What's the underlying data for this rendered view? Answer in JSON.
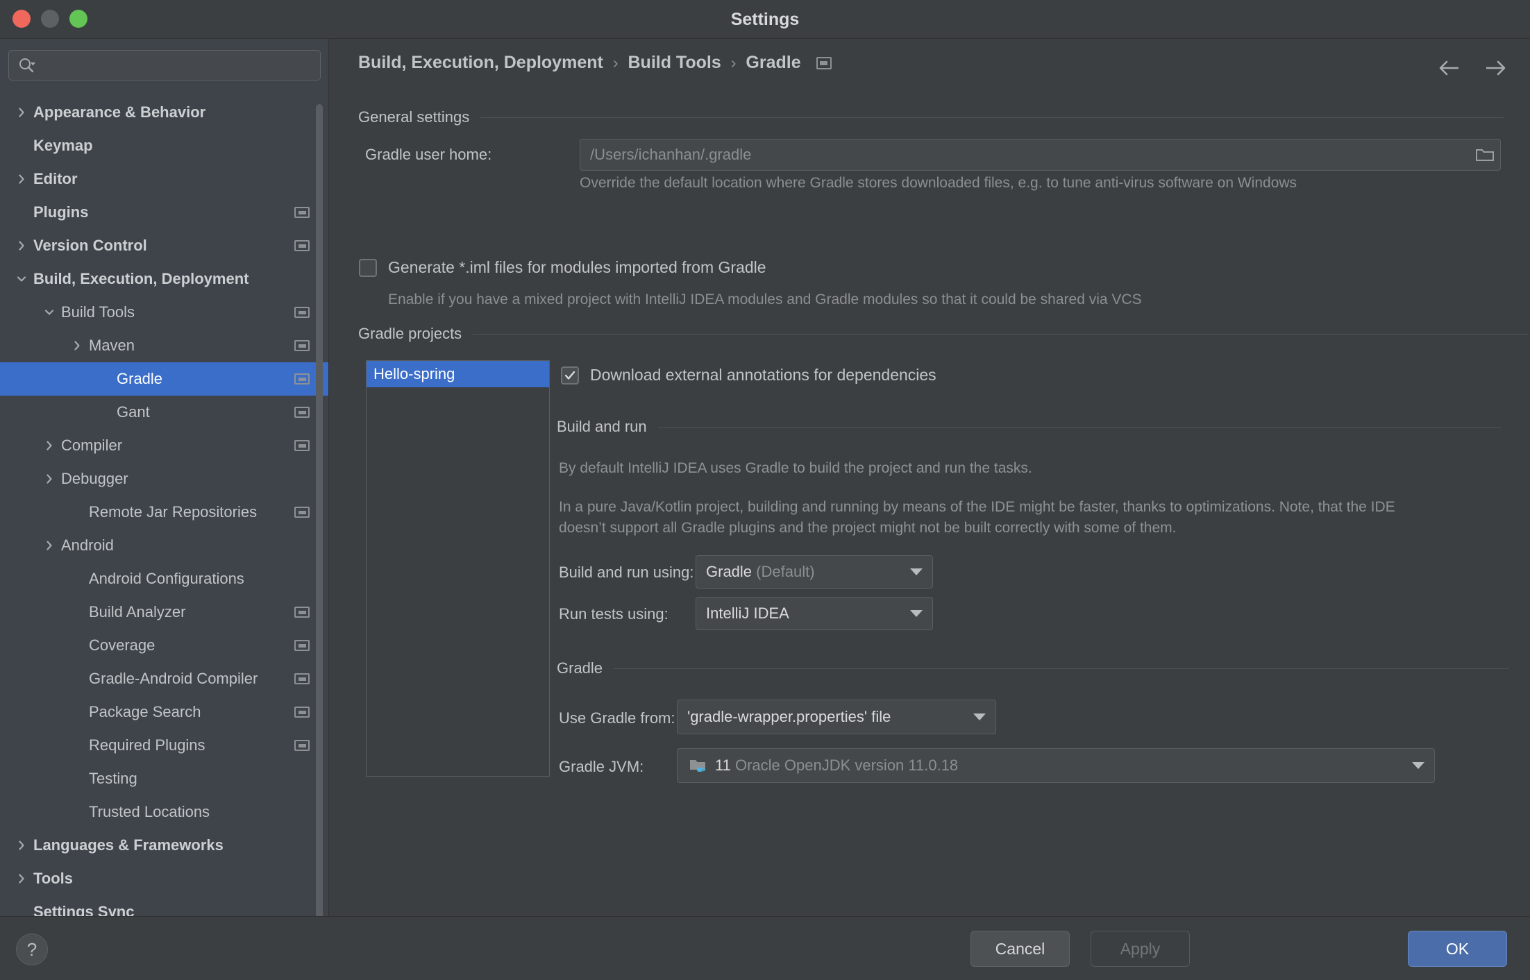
{
  "window": {
    "title": "Settings"
  },
  "sidebar": {
    "search": {
      "value": "",
      "placeholder": ""
    },
    "items": [
      {
        "label": "Appearance & Behavior",
        "indent": 0,
        "bold": true,
        "arrow": "right",
        "badge": false,
        "selected": false
      },
      {
        "label": "Keymap",
        "indent": 0,
        "bold": true,
        "arrow": "none",
        "badge": false,
        "selected": false
      },
      {
        "label": "Editor",
        "indent": 0,
        "bold": true,
        "arrow": "right",
        "badge": false,
        "selected": false
      },
      {
        "label": "Plugins",
        "indent": 0,
        "bold": true,
        "arrow": "none",
        "badge": true,
        "selected": false
      },
      {
        "label": "Version Control",
        "indent": 0,
        "bold": true,
        "arrow": "right",
        "badge": true,
        "selected": false
      },
      {
        "label": "Build, Execution, Deployment",
        "indent": 0,
        "bold": true,
        "arrow": "down",
        "badge": false,
        "selected": false
      },
      {
        "label": "Build Tools",
        "indent": 1,
        "bold": false,
        "arrow": "down",
        "badge": true,
        "selected": false
      },
      {
        "label": "Maven",
        "indent": 2,
        "bold": false,
        "arrow": "right",
        "badge": true,
        "selected": false
      },
      {
        "label": "Gradle",
        "indent": 3,
        "bold": false,
        "arrow": "none",
        "badge": true,
        "selected": true
      },
      {
        "label": "Gant",
        "indent": 3,
        "bold": false,
        "arrow": "none",
        "badge": true,
        "selected": false
      },
      {
        "label": "Compiler",
        "indent": 1,
        "bold": false,
        "arrow": "right",
        "badge": true,
        "selected": false
      },
      {
        "label": "Debugger",
        "indent": 1,
        "bold": false,
        "arrow": "right",
        "badge": false,
        "selected": false
      },
      {
        "label": "Remote Jar Repositories",
        "indent": 2,
        "bold": false,
        "arrow": "none",
        "badge": true,
        "selected": false
      },
      {
        "label": "Android",
        "indent": 1,
        "bold": false,
        "arrow": "right",
        "badge": false,
        "selected": false
      },
      {
        "label": "Android Configurations",
        "indent": 2,
        "bold": false,
        "arrow": "none",
        "badge": false,
        "selected": false
      },
      {
        "label": "Build Analyzer",
        "indent": 2,
        "bold": false,
        "arrow": "none",
        "badge": true,
        "selected": false
      },
      {
        "label": "Coverage",
        "indent": 2,
        "bold": false,
        "arrow": "none",
        "badge": true,
        "selected": false
      },
      {
        "label": "Gradle-Android Compiler",
        "indent": 2,
        "bold": false,
        "arrow": "none",
        "badge": true,
        "selected": false
      },
      {
        "label": "Package Search",
        "indent": 2,
        "bold": false,
        "arrow": "none",
        "badge": true,
        "selected": false
      },
      {
        "label": "Required Plugins",
        "indent": 2,
        "bold": false,
        "arrow": "none",
        "badge": true,
        "selected": false
      },
      {
        "label": "Testing",
        "indent": 2,
        "bold": false,
        "arrow": "none",
        "badge": false,
        "selected": false
      },
      {
        "label": "Trusted Locations",
        "indent": 2,
        "bold": false,
        "arrow": "none",
        "badge": false,
        "selected": false
      },
      {
        "label": "Languages & Frameworks",
        "indent": 0,
        "bold": true,
        "arrow": "right",
        "badge": false,
        "selected": false
      },
      {
        "label": "Tools",
        "indent": 0,
        "bold": true,
        "arrow": "right",
        "badge": false,
        "selected": false
      },
      {
        "label": "Settings Sync",
        "indent": 0,
        "bold": true,
        "arrow": "none",
        "badge": false,
        "selected": false
      }
    ]
  },
  "header": {
    "breadcrumb": [
      "Build, Execution, Deployment",
      "Build Tools",
      "Gradle"
    ],
    "separator": "›"
  },
  "general_settings": {
    "title": "General settings",
    "gradle_user_home_label": "Gradle user home:",
    "gradle_user_home_value": "",
    "gradle_user_home_placeholder": "/Users/ichanhan/.gradle",
    "gradle_user_home_hint": "Override the default location where Gradle stores downloaded files, e.g. to tune anti-virus software on Windows",
    "generate_iml_label": "Generate *.iml files for modules imported from Gradle",
    "generate_iml_checked": false,
    "generate_iml_hint": "Enable if you have a mixed project with IntelliJ IDEA modules and Gradle modules so that it could be shared via VCS"
  },
  "gradle_projects": {
    "title": "Gradle projects",
    "projects": [
      "Hello-spring"
    ],
    "selected_project": "Hello-spring",
    "download_annotations_label": "Download external annotations for dependencies",
    "download_annotations_checked": true
  },
  "build_and_run": {
    "title": "Build and run",
    "paragraph_1": "By default IntelliJ IDEA uses Gradle to build the project and run the tasks.",
    "paragraph_2": "In a pure Java/Kotlin project, building and running by means of the IDE might be faster, thanks to optimizations. Note, that the IDE doesn’t support all Gradle plugins and the project might not be built correctly with some of them.",
    "build_run_using_label": "Build and run using:",
    "build_run_using_value": "Gradle",
    "build_run_using_suffix": "(Default)",
    "run_tests_using_label": "Run tests using:",
    "run_tests_using_value": "IntelliJ IDEA"
  },
  "gradle_section": {
    "title": "Gradle",
    "use_gradle_from_label": "Use Gradle from:",
    "use_gradle_from_value": "'gradle-wrapper.properties' file",
    "gradle_jvm_label": "Gradle JVM:",
    "gradle_jvm_version": "11",
    "gradle_jvm_description": "Oracle OpenJDK version 11.0.18"
  },
  "footer": {
    "help_label": "?",
    "cancel_label": "Cancel",
    "apply_label": "Apply",
    "ok_label": "OK"
  },
  "colors": {
    "accent_blue": "#3b6ec9",
    "ok_button": "#4b6eab",
    "panel_bg": "#3c3f41",
    "sidebar_bg": "#3f434a"
  }
}
